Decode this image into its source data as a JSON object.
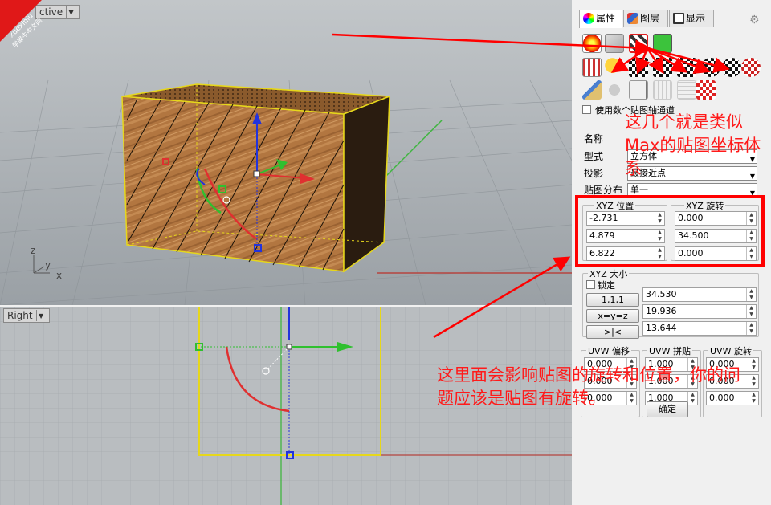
{
  "viewports": {
    "perspective": {
      "label": "ctive"
    },
    "right": {
      "label": "Right"
    }
  },
  "axis_labels": {
    "z": "z",
    "y": "y",
    "x": "x"
  },
  "panel": {
    "tabs": [
      {
        "label": "属性",
        "icon": "color-wheel-icon"
      },
      {
        "label": "图层",
        "icon": "layers-icon"
      },
      {
        "label": "显示",
        "icon": "monitor-icon"
      }
    ],
    "use_mapping_channels": "使用数个贴图轴通道",
    "fields": {
      "name_label": "名称",
      "type_label": "型式",
      "type_value": "立方体",
      "projection_label": "投影",
      "projection_value": "最接近点",
      "distribution_label": "贴图分布",
      "distribution_value": "单一"
    },
    "xyz_position": {
      "title": "XYZ 位置",
      "values": [
        "-2.731",
        "4.879",
        "6.822"
      ]
    },
    "xyz_rotation": {
      "title": "XYZ 旋转",
      "values": [
        "0.000",
        "34.500",
        "0.000"
      ]
    },
    "xyz_size": {
      "title": "XYZ 大小",
      "lock_label": "锁定",
      "buttons": [
        "1,1,1",
        "x=y=z",
        ">|<"
      ],
      "values": [
        "34.530",
        "19.936",
        "13.644"
      ]
    },
    "uvw_offset": {
      "title": "UVW 偏移",
      "values": [
        "0.000",
        "0.000",
        "0.000"
      ]
    },
    "uvw_repeat": {
      "title": "UVW 拼贴",
      "values": [
        "1.000",
        "1.000",
        "1.000"
      ]
    },
    "uvw_rotation": {
      "title": "UVW 旋转",
      "values": [
        "0.000",
        "0.000",
        "0.000"
      ]
    },
    "ok_label": "确定"
  },
  "annotations": {
    "top": "这几个就是类似Max的贴图坐标体系",
    "bottom": "这里面会影响贴图的旋转和位置，你的问题应该是贴图有旋转。"
  },
  "watermark": {
    "line1": "xuexiniu",
    "line2": "学犀牛中文网"
  },
  "colors": {
    "accent_red": "#ff0000",
    "annotation_red": "#ff1a1a",
    "wood": "#b57b45",
    "selection_yellow": "#f2e20c"
  }
}
